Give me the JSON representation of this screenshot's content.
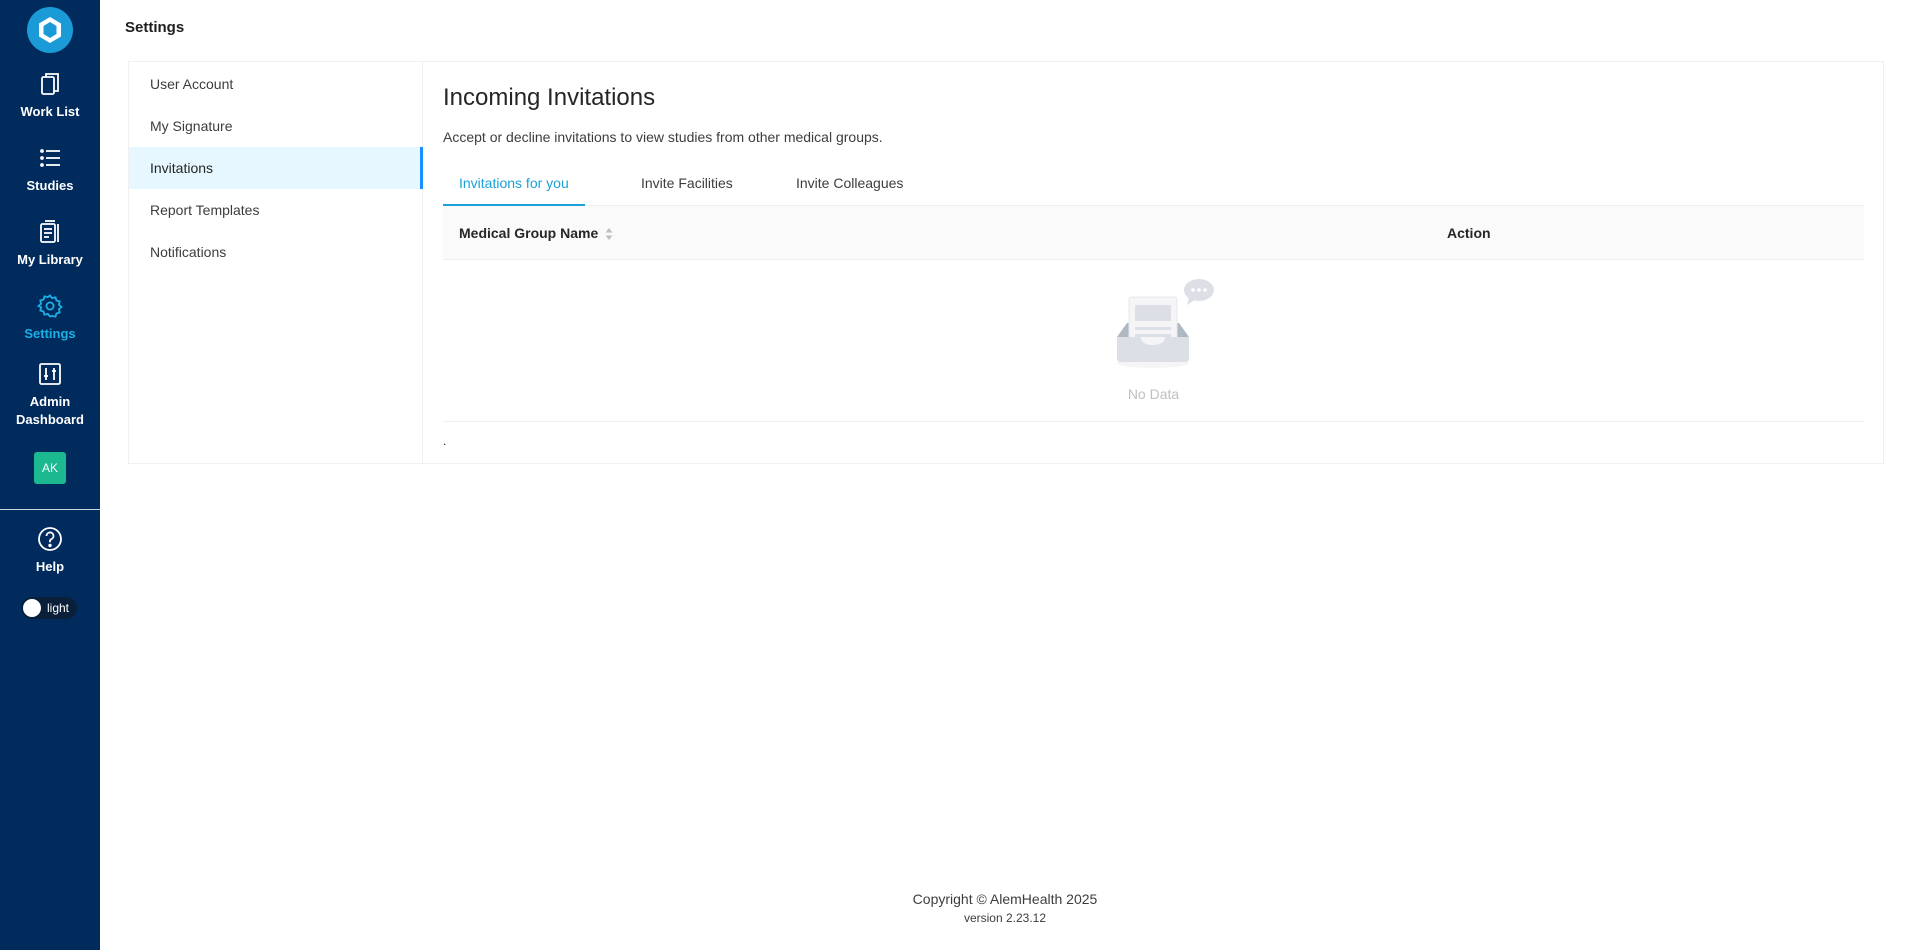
{
  "nav": {
    "items": [
      {
        "label": "Work List",
        "icon": "worklist-icon"
      },
      {
        "label": "Studies",
        "icon": "list-icon"
      },
      {
        "label": "My Library",
        "icon": "library-icon"
      },
      {
        "label": "Settings",
        "icon": "gear-icon",
        "active": true
      },
      {
        "label": "Admin",
        "label2": "Dashboard",
        "icon": "sliders-icon"
      }
    ],
    "avatar": "AK",
    "help": "Help",
    "theme": "light",
    "active_color": "#1ab0e6",
    "background": "#002b5c"
  },
  "header": {
    "title": "Settings"
  },
  "submenu": {
    "items": [
      "User Account",
      "My Signature",
      "Invitations",
      "Report Templates",
      "Notifications"
    ],
    "selected": "Invitations"
  },
  "content": {
    "title": "Incoming Invitations",
    "description": "Accept or decline invitations to view studies from other medical groups.",
    "tabs": [
      "Invitations for you",
      "Invite Facilities",
      "Invite Colleagues"
    ],
    "active_tab": "Invitations for you",
    "table": {
      "columns": [
        "Medical Group Name",
        "Action"
      ],
      "rows": [],
      "empty_text": "No Data"
    },
    "trailing_text": "."
  },
  "footer": {
    "copyright": "Copyright © AlemHealth 2025",
    "version": "version 2.23.12"
  }
}
